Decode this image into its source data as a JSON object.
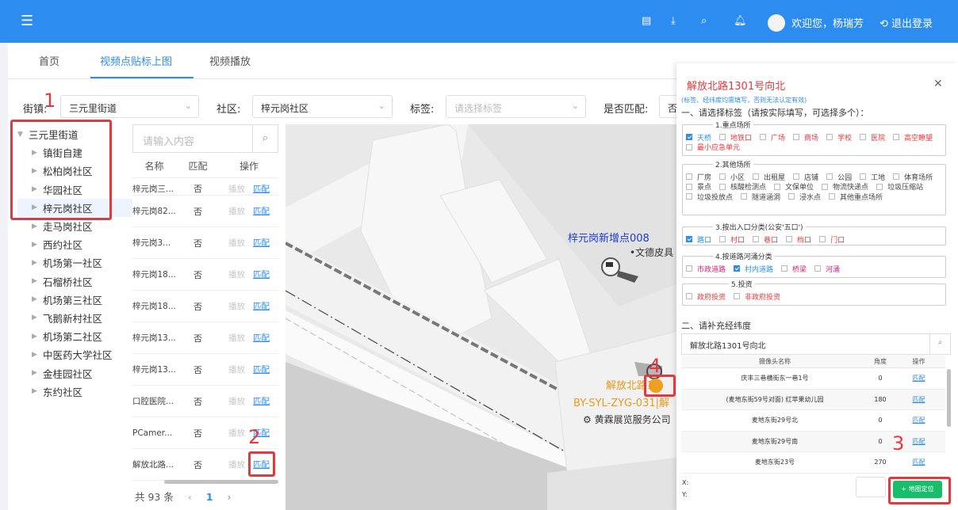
{
  "header": {
    "welcome": "欢迎您，杨瑞芳",
    "logout": "退出登录",
    "icons": [
      "menu-icon",
      "document-icon",
      "download-icon",
      "search-icon",
      "bell-icon",
      "user-avatar"
    ]
  },
  "tabs": [
    {
      "label": "首页"
    },
    {
      "label": "视频点贴标上图",
      "active": true
    },
    {
      "label": "视频播放"
    }
  ],
  "filters": {
    "street_label": "街镇:",
    "street_value": "三元里街道",
    "community_label": "社区:",
    "community_value": "梓元岗社区",
    "tag_label": "标签:",
    "tag_placeholder": "请选择标签",
    "match_label": "是否匹配:",
    "match_value": "否"
  },
  "tree": {
    "root": "三元里街道",
    "children": [
      "镇街自建",
      "松柏岗社区",
      "华园社区",
      "梓元岗社区",
      "走马岗社区",
      "西约社区",
      "机场第一社区",
      "石榴桥社区",
      "机场第三社区",
      "飞鹅新村社区",
      "机场第二社区",
      "中医药大学社区",
      "金桂园社区",
      "东约社区"
    ],
    "selected": "梓元岗社区"
  },
  "list": {
    "search_placeholder": "请输入内容",
    "headers": [
      "名称",
      "匹配",
      "操作"
    ],
    "rows": [
      {
        "name": "梓元岗三...",
        "match": "否"
      },
      {
        "name": "梓元岗82...",
        "match": "否"
      },
      {
        "name": "梓元岗3...",
        "match": "否"
      },
      {
        "name": "梓元岗18...",
        "match": "否"
      },
      {
        "name": "梓元岗18...",
        "match": "否"
      },
      {
        "name": "梓元岗13...",
        "match": "否"
      },
      {
        "name": "梓元岗13...",
        "match": "否"
      },
      {
        "name": "口腔医院...",
        "match": "否"
      },
      {
        "name": "PCamer...",
        "match": "否"
      },
      {
        "name": "解放北路...",
        "match": "否"
      }
    ],
    "play_label": "播放",
    "match_label": "匹配",
    "total": "共 93 条",
    "page": "1",
    "prev": "‹",
    "next": "›"
  },
  "map": {
    "labels": {
      "point_name": "梓元岗新增点008",
      "poi": "•文德皮具",
      "camera_name": "解放北路1",
      "camera_code": "BY-SYL-ZYG-031|解",
      "company": "黄霖展览服务公司"
    }
  },
  "panel": {
    "title": "解放北路1301号向北",
    "subtitle": "(标签、经纬度均需填写，否则无法认定有效)",
    "section1": "一、请选择标签（请按实际填写，可选择多个）：",
    "groups": [
      {
        "title": "1.重点场所",
        "options": [
          {
            "label": "天桥",
            "checked": true,
            "color": "red"
          },
          {
            "label": "地铁口",
            "checked": false,
            "color": "red"
          },
          {
            "label": "广场",
            "checked": false,
            "color": "red"
          },
          {
            "label": "商场",
            "checked": false,
            "color": "red"
          },
          {
            "label": "学校",
            "checked": false,
            "color": "red"
          },
          {
            "label": "医院",
            "checked": false,
            "color": "red"
          },
          {
            "label": "高空瞭望",
            "checked": false,
            "color": "red"
          },
          {
            "label": "最小应急单元",
            "checked": false,
            "color": "red"
          }
        ]
      },
      {
        "title": "2.其他场所",
        "options": [
          {
            "label": "厂房",
            "checked": false,
            "color": "dark"
          },
          {
            "label": "小区",
            "checked": false,
            "color": "dark"
          },
          {
            "label": "出租屋",
            "checked": false,
            "color": "dark"
          },
          {
            "label": "店铺",
            "checked": false,
            "color": "dark"
          },
          {
            "label": "公园",
            "checked": false,
            "color": "dark"
          },
          {
            "label": "工地",
            "checked": false,
            "color": "dark"
          },
          {
            "label": "体育场所",
            "checked": false,
            "color": "dark"
          },
          {
            "label": "景点",
            "checked": false,
            "color": "dark"
          },
          {
            "label": "核酸检测点",
            "checked": false,
            "color": "dark"
          },
          {
            "label": "文保单位",
            "checked": false,
            "color": "dark"
          },
          {
            "label": "物流快递点",
            "checked": false,
            "color": "dark"
          },
          {
            "label": "垃圾压缩站",
            "checked": false,
            "color": "dark"
          },
          {
            "label": "垃圾投放点",
            "checked": false,
            "color": "dark"
          },
          {
            "label": "隧道涵洞",
            "checked": false,
            "color": "dark"
          },
          {
            "label": "浸水点",
            "checked": false,
            "color": "dark"
          },
          {
            "label": "其他重点场所",
            "checked": false,
            "color": "dark"
          }
        ]
      },
      {
        "title": "3.按出入口分类(公安'五口')",
        "options": [
          {
            "label": "路口",
            "checked": true,
            "color": "red"
          },
          {
            "label": "村口",
            "checked": false,
            "color": "red"
          },
          {
            "label": "巷口",
            "checked": false,
            "color": "red"
          },
          {
            "label": "档口",
            "checked": false,
            "color": "red"
          },
          {
            "label": "门口",
            "checked": false,
            "color": "red"
          }
        ]
      },
      {
        "title": "4.按道路河涌分类",
        "options": [
          {
            "label": "市政道路",
            "checked": false,
            "color": "magenta"
          },
          {
            "label": "村内道路",
            "checked": true,
            "color": "magenta"
          },
          {
            "label": "桥梁",
            "checked": false,
            "color": "magenta"
          },
          {
            "label": "河涌",
            "checked": false,
            "color": "magenta"
          }
        ]
      },
      {
        "title": "5.投资",
        "options": [
          {
            "label": "政府投资",
            "checked": false,
            "color": "red"
          },
          {
            "label": "非政府投资",
            "checked": false,
            "color": "red"
          }
        ]
      }
    ],
    "section2": "二、请补充经纬度",
    "address_value": "解放北路1301号向北",
    "table_headers": [
      "摄像头名称",
      "角度",
      "操作"
    ],
    "table_rows": [
      {
        "name": "庆丰三巷横街东一巷1号",
        "angle": "0",
        "op": "匹配"
      },
      {
        "name": "(麦地东街59号对面) 红苹果幼儿园",
        "angle": "180",
        "op": "匹配"
      },
      {
        "name": "麦地东街29号北",
        "angle": "0",
        "op": "匹配"
      },
      {
        "name": "麦地东街29号南",
        "angle": "0",
        "op": "匹配"
      },
      {
        "name": "麦地东街23号",
        "angle": "270",
        "op": "匹配"
      }
    ],
    "x_label": "X:",
    "y_label": "Y:",
    "locate_button": "+ 地图定位"
  },
  "annotations": [
    "1",
    "2",
    "3",
    "4"
  ],
  "colors": {
    "primary": "#2d8cf0",
    "annotation": "#e4393c",
    "success": "#19be6b"
  }
}
